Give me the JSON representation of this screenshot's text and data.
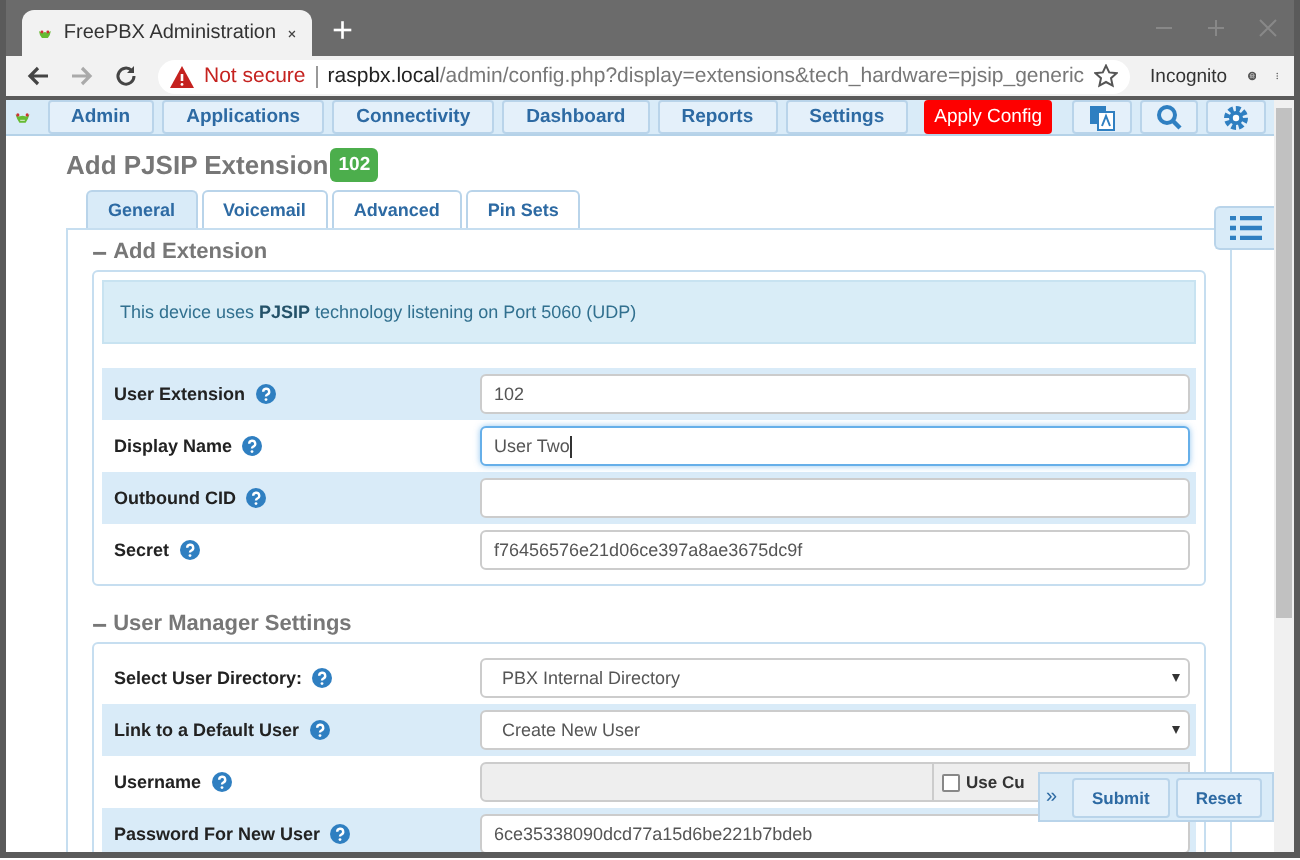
{
  "browser": {
    "tab_title": "FreePBX Administration",
    "new_tab": "+",
    "security": "Not secure",
    "host": "raspbx.local",
    "path": "/admin/config.php?display=extensions&tech_hardware=pjsip_generic",
    "profile": "Incognito"
  },
  "nav": {
    "items": [
      "Admin",
      "Applications",
      "Connectivity",
      "Dashboard",
      "Reports",
      "Settings"
    ],
    "apply": "Apply Config"
  },
  "page": {
    "title": "Add PJSIP Extension",
    "badge": "102",
    "tabs": [
      {
        "label": "General",
        "selected": true
      },
      {
        "label": "Voicemail",
        "selected": false
      },
      {
        "label": "Advanced",
        "selected": false
      },
      {
        "label": "Pin Sets",
        "selected": false
      }
    ],
    "sections": [
      {
        "collapse": "−",
        "title": "Add Extension",
        "info": "This device uses **PJSIP** technology listening on Port 5060 (UDP)",
        "rows": [
          {
            "kind": "text",
            "label": "User Extension",
            "value": "102",
            "focused": false,
            "disabled": false
          },
          {
            "kind": "text",
            "label": "Display Name",
            "value": "User Two",
            "focused": true,
            "disabled": false
          },
          {
            "kind": "text",
            "label": "Outbound CID",
            "focused": false,
            "disabled": false
          },
          {
            "kind": "text",
            "label": "Secret",
            "value": "f76456576e21d06ce397a8ae3675dc9f",
            "focused": false,
            "disabled": false
          }
        ]
      },
      {
        "collapse": "−",
        "title": "User Manager Settings",
        "rows": [
          {
            "kind": "select",
            "label": "Select User Directory:",
            "value": "PBX Internal Directory"
          },
          {
            "kind": "select",
            "label": "Link to a Default User",
            "value": "Create New User"
          },
          {
            "kind": "username",
            "label": "Username",
            "focused": false,
            "disabled": true,
            "option": {
              "label": "Use Cu",
              "checked": false
            }
          },
          {
            "kind": "text",
            "label": "Password For New User",
            "value": "6ce35338090dcd77a15d6be221b7bdeb",
            "focused": false,
            "disabled": false
          }
        ]
      }
    ]
  },
  "actions": {
    "toggle": "»",
    "buttons": [
      "Submit",
      "Reset"
    ]
  }
}
